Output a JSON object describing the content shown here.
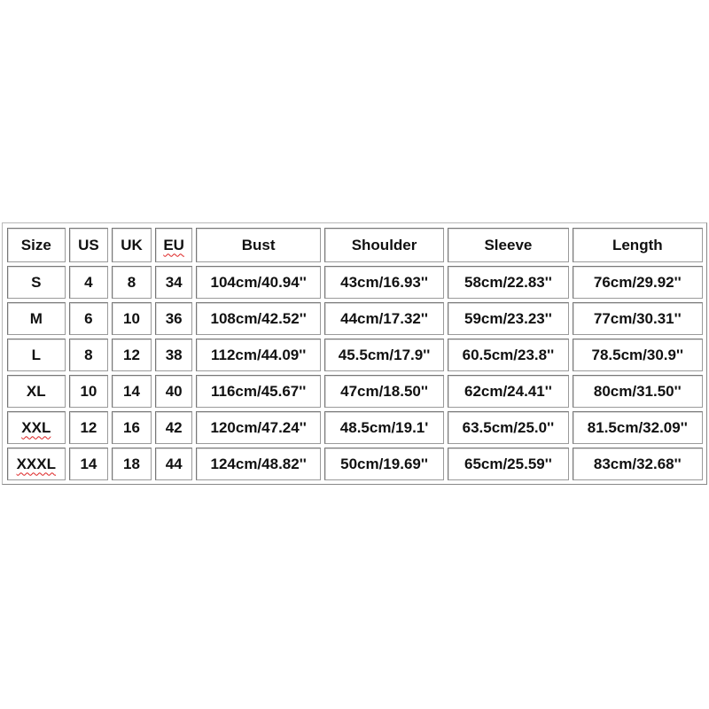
{
  "headers": [
    "Size",
    "US",
    "UK",
    "EU",
    "Bust",
    "Shoulder",
    "Sleeve",
    "Length"
  ],
  "rows": [
    [
      "S",
      "4",
      "8",
      "34",
      "104cm/40.94''",
      "43cm/16.93''",
      "58cm/22.83''",
      "76cm/29.92''"
    ],
    [
      "M",
      "6",
      "10",
      "36",
      "108cm/42.52''",
      "44cm/17.32''",
      "59cm/23.23''",
      "77cm/30.31''"
    ],
    [
      "L",
      "8",
      "12",
      "38",
      "112cm/44.09''",
      "45.5cm/17.9''",
      "60.5cm/23.8''",
      "78.5cm/30.9''"
    ],
    [
      "XL",
      "10",
      "14",
      "40",
      "116cm/45.67''",
      "47cm/18.50''",
      "62cm/24.41''",
      "80cm/31.50''"
    ],
    [
      "XXL",
      "12",
      "16",
      "42",
      "120cm/47.24''",
      "48.5cm/19.1'",
      "63.5cm/25.0''",
      "81.5cm/32.09''"
    ],
    [
      "XXXL",
      "14",
      "18",
      "44",
      "124cm/48.82''",
      "50cm/19.69''",
      "65cm/25.59''",
      "83cm/32.68''"
    ]
  ],
  "spellcheck_marked": [
    "EU",
    "XXL",
    "XXXL"
  ],
  "colors": {
    "text": "#111111",
    "border": "#9a9a9a",
    "spellcheck": "#dd2222"
  }
}
